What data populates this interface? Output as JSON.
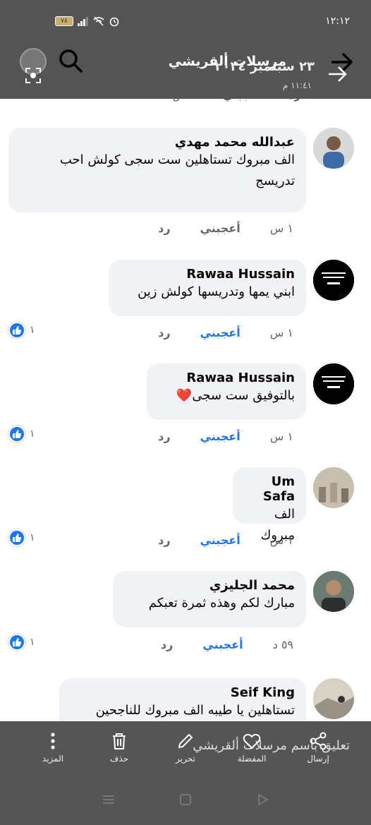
{
  "statusbar": {
    "time": "١٢:١٢",
    "battery": "٧٨"
  },
  "header": {
    "title": "مرسلات ألقريشي",
    "date": "٢٣ سبتمبر ٢٠٢٤",
    "time": "١١:٤١ م"
  },
  "prev_row": {
    "time": "١ س",
    "like": "أعجبني",
    "reply": "رد"
  },
  "comments": [
    {
      "name": "عبدالله محمد مهدي",
      "text": "الف مبروك تستاهلين ست سجى كولش احب تدريسج",
      "time": "١ س",
      "like": "أعجبني",
      "reply": "رد",
      "likes": ""
    },
    {
      "name": "Rawaa Hussain",
      "text": "ابني يمها وتدريسها كولش زين",
      "time": "١ س",
      "like": "أعجبني",
      "reply": "رد",
      "likes": "١"
    },
    {
      "name": "Rawaa Hussain",
      "text": "بالتوفيق ست سجى❤️",
      "time": "١ س",
      "like": "أعجبني",
      "reply": "رد",
      "likes": "١"
    },
    {
      "name": "Um Safa",
      "text": "الف مبروك",
      "time": "١ س",
      "like": "أعجبني",
      "reply": "رد",
      "likes": "١"
    },
    {
      "name": "محمد الجليزي",
      "text": "مبارك لكم  وهذه ثمرة تعبكم",
      "time": "٥٩ د",
      "like": "أعجبني",
      "reply": "رد",
      "likes": "١"
    },
    {
      "name": "Seif King",
      "text": "تستاهلين يا طيبه الف مبروك للناجحين"
    }
  ],
  "composer": {
    "placeholder": "تعليق باسم مرسلات ألقريشي"
  },
  "toolbar": {
    "share": "إرسال",
    "favorite": "المفضلة",
    "edit": "تحرير",
    "delete": "حذف",
    "more": "المزيد"
  },
  "colors": {
    "accent": "#1877f2",
    "bubble": "#f0f2f5",
    "overlay": "#545454"
  }
}
